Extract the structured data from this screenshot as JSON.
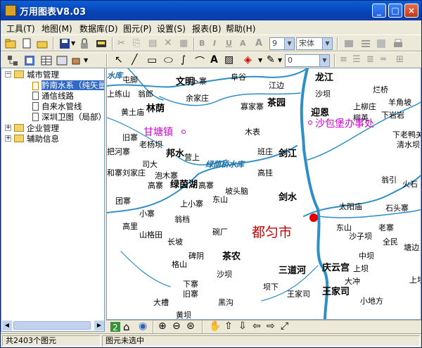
{
  "window": {
    "title": "万用图表V8.03"
  },
  "menu": [
    "工具(T)",
    "地图(M)",
    "数据库(D)",
    "图元(P)",
    "设置(S)",
    "报表(B)",
    "帮助(H)"
  ],
  "toolbar1": {
    "font_size": "9",
    "font_name": "宋体"
  },
  "toolbar2": {
    "line_width": "0"
  },
  "tree": {
    "root": "城市管理",
    "children": [
      "黔南水系（纯矢量",
      "通信线路",
      "自来水管线",
      "深圳卫图（局部）"
    ],
    "roots": [
      "企业管理",
      "辅助信息"
    ]
  },
  "map": {
    "labels_normal": [
      {
        "t": "屯脚"
      },
      {
        "t": "文明"
      },
      {
        "t": "卜寨"
      },
      {
        "t": "阜谷"
      },
      {
        "t": "龙江"
      },
      {
        "t": "上练山"
      },
      {
        "t": "翁郎"
      },
      {
        "t": "余家庄"
      },
      {
        "t": "江边"
      },
      {
        "t": "沙坝"
      },
      {
        "t": "黄土庙"
      },
      {
        "t": "寡家寨"
      },
      {
        "t": "羊角坡"
      },
      {
        "t": "上柳庄"
      },
      {
        "t": "下岩岩"
      },
      {
        "t": "柳英"
      },
      {
        "t": "木表"
      },
      {
        "t": "下老鸭关"
      },
      {
        "t": "旧寨"
      },
      {
        "t": "清水坝"
      },
      {
        "t": "老杨坝"
      },
      {
        "t": "把河寨"
      },
      {
        "t": "营上"
      },
      {
        "t": "班庄"
      },
      {
        "t": "刘家庄"
      },
      {
        "t": "司大"
      },
      {
        "t": "和寨"
      },
      {
        "t": "泡木寨"
      },
      {
        "t": "高挂"
      },
      {
        "t": "翁引"
      },
      {
        "t": "高寨"
      },
      {
        "t": "高寨"
      },
      {
        "t": "坡头脑"
      },
      {
        "t": "火石"
      },
      {
        "t": "团寨"
      },
      {
        "t": "上小寨"
      },
      {
        "t": "东山"
      },
      {
        "t": "太阳庙"
      },
      {
        "t": "石头寨"
      },
      {
        "t": "小寨"
      },
      {
        "t": "翁档"
      },
      {
        "t": "东山"
      },
      {
        "t": "老寨"
      },
      {
        "t": "高里"
      },
      {
        "t": "山格田"
      },
      {
        "t": "碗厂"
      },
      {
        "t": "沙子坝"
      },
      {
        "t": "长坡"
      },
      {
        "t": "全民"
      },
      {
        "t": "中坝"
      },
      {
        "t": "塘边"
      },
      {
        "t": "碑阴"
      },
      {
        "t": "格山"
      },
      {
        "t": "上坝"
      },
      {
        "t": "沙坝"
      },
      {
        "t": "大冲"
      },
      {
        "t": "下寨"
      },
      {
        "t": "坝下"
      },
      {
        "t": "上坝"
      },
      {
        "t": "旧寨"
      },
      {
        "t": "王家司"
      },
      {
        "t": "大槽"
      },
      {
        "t": "黑沟"
      },
      {
        "t": "小地方"
      },
      {
        "t": "黄坝"
      },
      {
        "t": "烂桥"
      }
    ],
    "labels_bold": [
      {
        "t": "林荫"
      },
      {
        "t": "茶园"
      },
      {
        "t": "迎恩"
      },
      {
        "t": "邦水"
      },
      {
        "t": "剑江"
      },
      {
        "t": "绿茵湖"
      },
      {
        "t": "剑水"
      },
      {
        "t": "茶农"
      },
      {
        "t": "三道河"
      },
      {
        "t": "庆云宫"
      },
      {
        "t": "王家司"
      }
    ],
    "labels_magenta": [
      {
        "t": "甘塘镇"
      },
      {
        "t": "沙包堡办事处"
      }
    ],
    "labels_water": [
      {
        "t": "水库"
      },
      {
        "t": "绿荫桥水库"
      }
    ],
    "city": "都匀市"
  },
  "status": {
    "count": "共2403个图元",
    "selection": "图元未选中"
  },
  "colors": {
    "river": "#2e8fc4",
    "titlebar": "#0842b4",
    "city_label": "#c00000",
    "point": "#d000d0"
  }
}
